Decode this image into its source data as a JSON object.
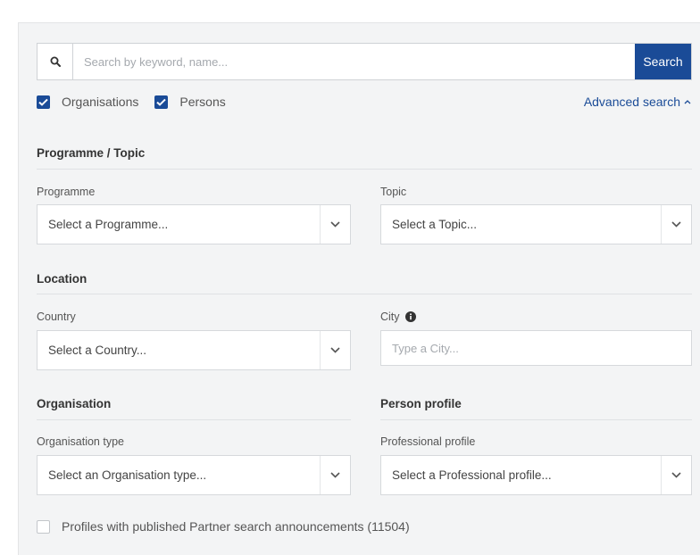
{
  "search": {
    "placeholder": "Search by keyword, name...",
    "button_label": "Search",
    "icon": "search-icon"
  },
  "filters": {
    "organisations_label": "Organisations",
    "organisations_checked": true,
    "persons_label": "Persons",
    "persons_checked": true,
    "advanced_label": "Advanced search",
    "advanced_icon": "chevron-up-icon"
  },
  "sections": {
    "programme_topic": {
      "title": "Programme / Topic",
      "programme_label": "Programme",
      "programme_value": "Select a Programme...",
      "topic_label": "Topic",
      "topic_value": "Select a Topic..."
    },
    "location": {
      "title": "Location",
      "country_label": "Country",
      "country_value": "Select a Country...",
      "city_label": "City",
      "city_placeholder": "Type a City...",
      "city_icon": "info-icon"
    },
    "organisation": {
      "title": "Organisation",
      "type_label": "Organisation type",
      "type_value": "Select an Organisation type..."
    },
    "person_profile": {
      "title": "Person profile",
      "professional_label": "Professional profile",
      "professional_value": "Select a Professional profile..."
    }
  },
  "announcements": {
    "label": "Profiles with published Partner search announcements (11504)",
    "checked": false
  },
  "colors": {
    "accent": "#1a4b97",
    "panel": "#f3f4f5"
  }
}
